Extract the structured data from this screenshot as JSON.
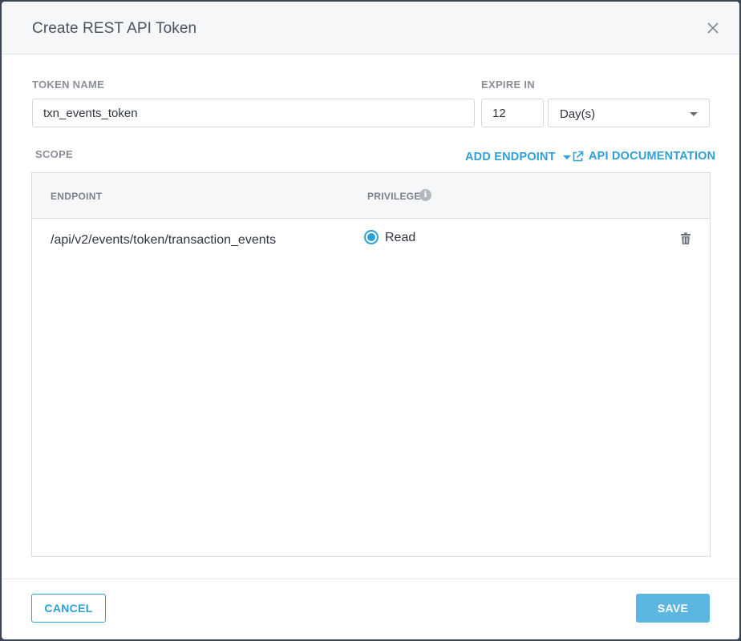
{
  "dialog": {
    "title": "Create REST API Token"
  },
  "form": {
    "token_name_label": "TOKEN NAME",
    "token_name_value": "txn_events_token",
    "expire_label": "EXPIRE IN",
    "expire_value": "12",
    "expire_unit": "Day(s)"
  },
  "scope": {
    "label": "SCOPE",
    "add_endpoint_label": "ADD ENDPOINT",
    "api_doc_label": "API DOCUMENTATION",
    "columns": {
      "endpoint": "ENDPOINT",
      "privilege": "PRIVILEGE"
    },
    "rows": [
      {
        "endpoint": "/api/v2/events/token/transaction_events",
        "privilege": "Read"
      }
    ]
  },
  "footer": {
    "cancel_label": "CANCEL",
    "save_label": "SAVE"
  },
  "icons": {
    "close": "close-icon",
    "caret": "chevron-down-icon",
    "external": "external-link-icon",
    "info": "info-icon",
    "trash": "trash-icon"
  },
  "colors": {
    "accent": "#2fa0d6",
    "save_button": "#5cb6df",
    "header_bg": "#f6f7f8"
  }
}
